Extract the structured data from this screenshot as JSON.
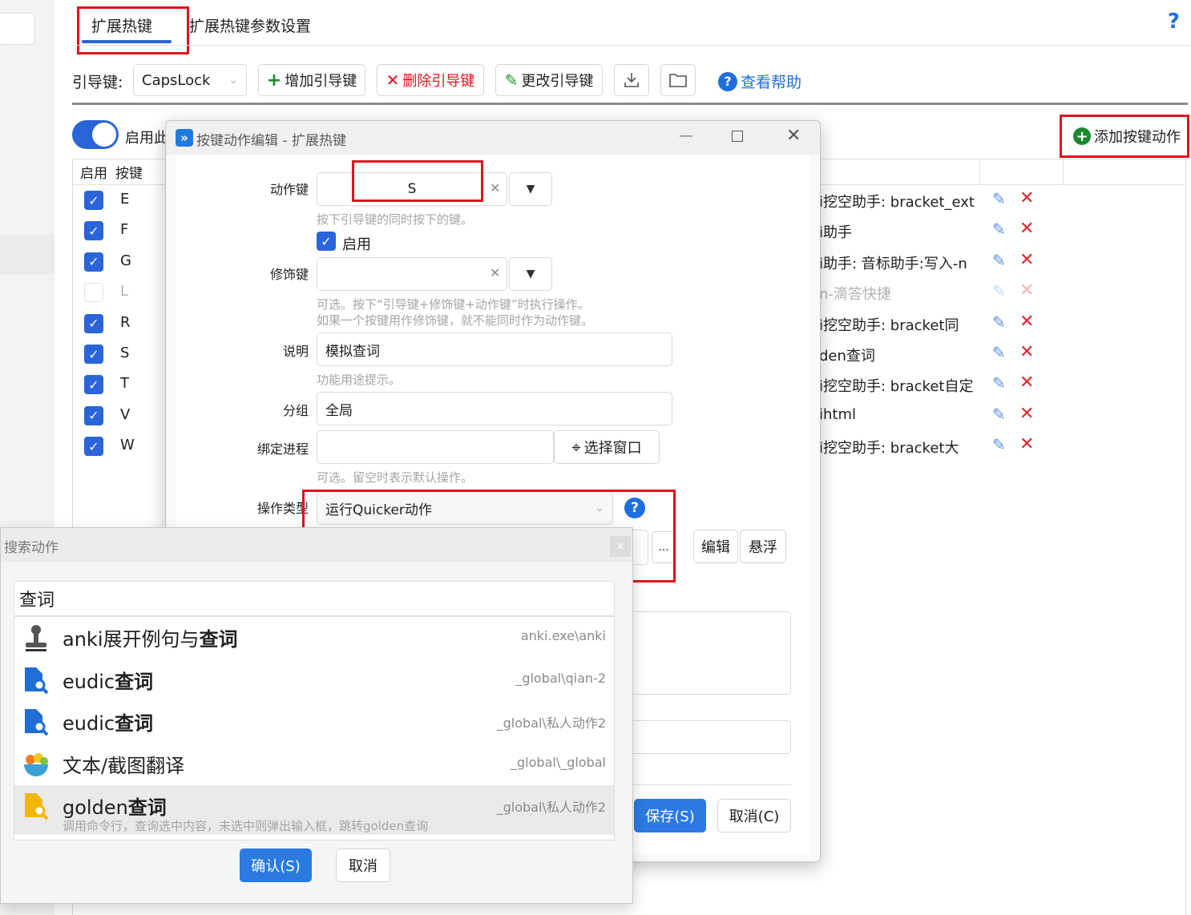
{
  "tabs": {
    "hotkeys": "扩展热键",
    "params": "扩展热键参数设置"
  },
  "help_icon": "?",
  "toolbar": {
    "leader_label": "引导键:",
    "leader_value": "CapsLock",
    "add_leader": "增加引导键",
    "delete_leader": "删除引导键",
    "change_leader": "更改引导键",
    "help_link": "查看帮助"
  },
  "enable_label": "启用此",
  "add_action": "添加按键动作",
  "table": {
    "headers": {
      "enabled": "启用",
      "key": "按键"
    },
    "rows": [
      {
        "key": "E",
        "enabled": true,
        "text": "i挖空助手: bracket_ext"
      },
      {
        "key": "F",
        "enabled": true,
        "text": "i助手"
      },
      {
        "key": "G",
        "enabled": true,
        "text": "i助手: 音标助手:写入-n"
      },
      {
        "key": "L",
        "enabled": false,
        "text": "n-滴答快捷"
      },
      {
        "key": "R",
        "enabled": true,
        "text": "i挖空助手: bracket同"
      },
      {
        "key": "S",
        "enabled": true,
        "text": "den查词"
      },
      {
        "key": "T",
        "enabled": true,
        "text": "i挖空助手: bracket自定"
      },
      {
        "key": "V",
        "enabled": true,
        "text": "ihtml"
      },
      {
        "key": "W",
        "enabled": true,
        "text": "i挖空助手: bracket大"
      }
    ]
  },
  "dialog": {
    "title": "按键动作编辑 - 扩展热键",
    "action_key_label": "动作键",
    "action_key_value": "S",
    "action_key_hint": "按下引导键的同时按下的键。",
    "enable_label": "启用",
    "modifier_label": "修饰键",
    "modifier_hint1": "可选。按下“引导键+修饰键+动作键”时执行操作。",
    "modifier_hint2": "如果一个按键用作修饰键，就不能同时作为动作键。",
    "desc_label": "说明",
    "desc_value": "模拟查词",
    "desc_hint": "功能用途提示。",
    "group_label": "分组",
    "group_value": "全局",
    "process_label": "绑定进程",
    "select_window": "选择窗口",
    "process_hint": "可选。留空时表示默认操作。",
    "op_type_label": "操作类型",
    "op_type_value": "运行Quicker动作",
    "edit_btn": "编辑",
    "float_btn": "悬浮",
    "dots_btn": "...",
    "save_btn": "保存(S)",
    "cancel_btn": "取消(C)"
  },
  "search": {
    "title": "搜索动作",
    "query": "查词",
    "clear_glyph": "×",
    "results": [
      {
        "prefix": "anki展开例句与",
        "bold": "查词",
        "path": "anki.exe\\anki",
        "icon": "stamp-icon"
      },
      {
        "prefix": "eudic",
        "bold": "查词",
        "path": "_global\\qian-2",
        "icon": "search-doc-icon"
      },
      {
        "prefix": "eudic",
        "bold": "查词",
        "path": "_global\\私人动作2",
        "icon": "search-doc-icon"
      },
      {
        "prefix": "文本/截图翻译",
        "bold": "",
        "path": "_global\\_global",
        "icon": "translate-bowl-icon"
      },
      {
        "prefix": "golden",
        "bold": "查词",
        "path": "_global\\私人动作2",
        "icon": "search-doc-yellow-icon",
        "sub": "调用命令行，查询选中内容，未选中则弹出输入框，跳转golden查询"
      }
    ],
    "confirm": "确认(S)",
    "cancel": "取消"
  },
  "colors": {
    "accent": "#2a64d8",
    "danger": "#e0111b",
    "highlight_box": "#e0111b"
  }
}
